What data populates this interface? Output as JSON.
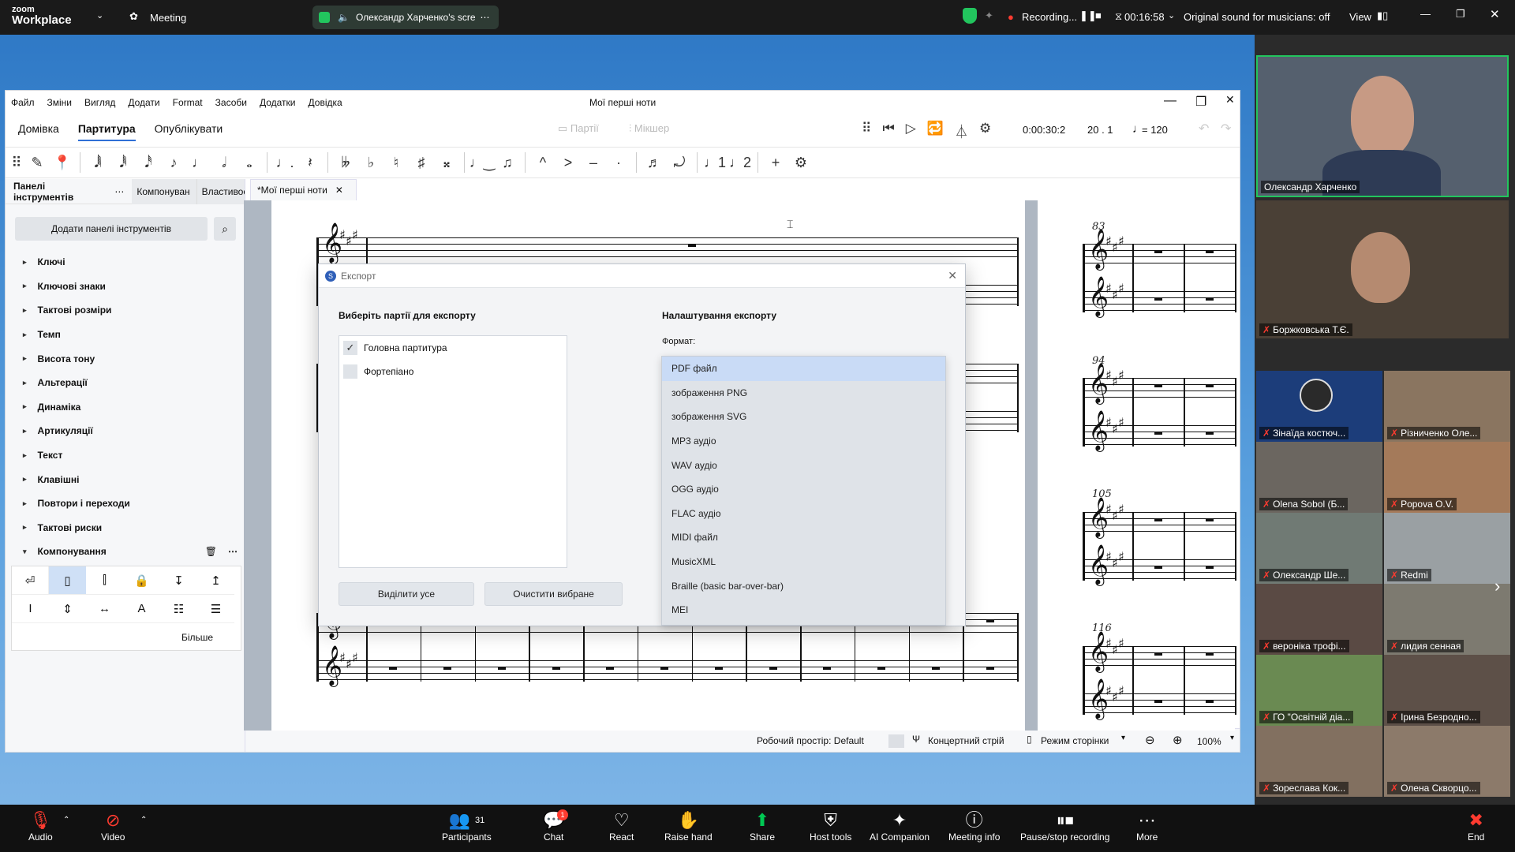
{
  "zoom": {
    "app_name_line1": "zoom",
    "app_name_line2": "Workplace",
    "meeting_label": "Meeting",
    "share_label": "Олександр Харченко's scre",
    "recording_label": "Recording...",
    "timer": "00:16:58",
    "sound_label": "Original sound for musicians: off",
    "view_label": "View"
  },
  "musescore": {
    "menu": [
      "Файл",
      "Зміни",
      "Вигляд",
      "Додати",
      "Format",
      "Засоби",
      "Додатки",
      "Довідка"
    ],
    "window_title": "Мої перші ноти",
    "tabs": [
      "Домівка",
      "Партитура",
      "Опублікувати"
    ],
    "active_tab": "Партитура",
    "parts_label": "Партії",
    "mixer_label": "Мікшер",
    "time": "0:00:30:2",
    "position": "20 . 1",
    "tempo": "= 120",
    "panel_tabs": [
      "Панелі інструментів",
      "Компонуван",
      "Властивос"
    ],
    "score_tab": "*Мої перші ноти",
    "add_palettes": "Додати панелі інструментів",
    "palettes": [
      "Ключі",
      "Ключові знаки",
      "Тактові розміри",
      "Темп",
      "Висота тону",
      "Альтерації",
      "Динаміка",
      "Артикуляції",
      "Текст",
      "Клавішні",
      "Повтори і переходи",
      "Тактові риски"
    ],
    "palette_open": "Компонування",
    "more_label": "Більше",
    "status_workspace": "Робочий простір: Default",
    "status_concert": "Концертний стрій",
    "status_pageview": "Режим сторінки",
    "status_zoom": "100%",
    "measure_numbers": [
      "17",
      "83",
      "94",
      "105",
      "116"
    ]
  },
  "export_dialog": {
    "title": "Експорт",
    "left_heading": "Виберіть партії для експорту",
    "parts": [
      {
        "label": "Головна партитура",
        "checked": true
      },
      {
        "label": "Фортепіано",
        "checked": false
      }
    ],
    "select_all": "Виділити усе",
    "clear": "Очистити вибране",
    "right_heading": "Налаштування експорту",
    "format_label": "Формат:",
    "formats": [
      "PDF файл",
      "зображення PNG",
      "зображення SVG",
      "MP3 аудіо",
      "WAV аудіо",
      "OGG аудіо",
      "FLAC аудіо",
      "MIDI файл",
      "MusicXML",
      "Braille (basic bar-over-bar)",
      "MEI"
    ],
    "selected_format": "PDF файл"
  },
  "participants": [
    "Олександр Харченко",
    "Боржковська Т.Є.",
    "Зінаїда костюч...",
    "Різниченко Оле...",
    "Olena Sobol (Б...",
    "Popova O.V.",
    "Олександр Ше...",
    "Redmi",
    "вероніка трофі...",
    "лидия сенная",
    "ГО \"Освітній діа...",
    "Ірина Безродно...",
    "Зореслава Кок...",
    "Олена Скворцо..."
  ],
  "bottom_bar": {
    "audio": "Audio",
    "video": "Video",
    "participants": "Participants",
    "participants_count": "31",
    "chat": "Chat",
    "chat_badge": "1",
    "react": "React",
    "raise_hand": "Raise hand",
    "share": "Share",
    "host_tools": "Host tools",
    "ai": "AI Companion",
    "meeting_info": "Meeting info",
    "pause_rec": "Pause/stop recording",
    "more": "More",
    "end": "End"
  },
  "colors": {
    "accent": "#2f6fd6",
    "share_bg": "#2f79c6",
    "selected_format": "#c9dbf6",
    "record_red": "#ff3b30",
    "share_green": "#00c853"
  }
}
